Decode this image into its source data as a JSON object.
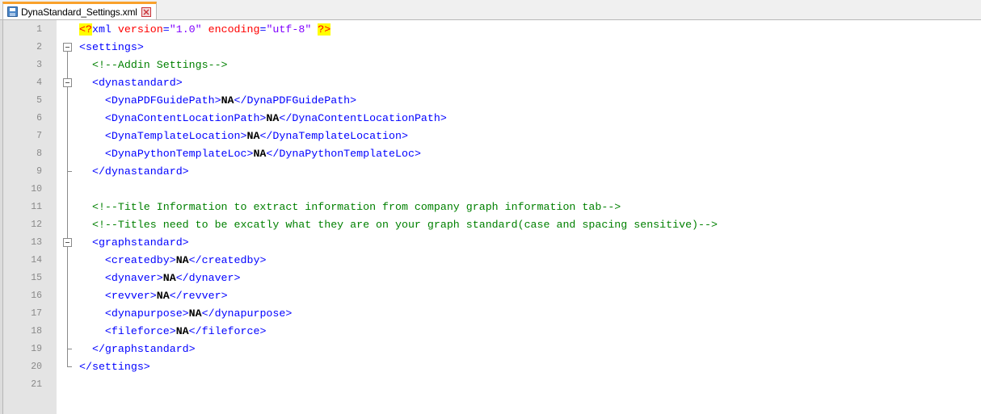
{
  "tab": {
    "filename": "DynaStandard_Settings.xml",
    "icon": "save-icon",
    "close_icon": "close-icon"
  },
  "colors": {
    "tag": "#0000ff",
    "attribute": "#ff0000",
    "string": "#8000ff",
    "comment": "#008000",
    "text": "#000000",
    "highlight": "#ffff00",
    "tab_accent": "#f9a12b"
  },
  "lines": [
    {
      "n": "1",
      "segs": [
        [
          "pi-hl",
          "<?"
        ],
        [
          "tag",
          "xml "
        ],
        [
          "attr",
          "version"
        ],
        [
          "tag",
          "="
        ],
        [
          "str",
          "\"1.0\""
        ],
        [
          "tag",
          " "
        ],
        [
          "attr",
          "encoding"
        ],
        [
          "tag",
          "="
        ],
        [
          "str",
          "\"utf-8\""
        ],
        [
          "tag",
          " "
        ],
        [
          "pi-hl",
          "?>"
        ]
      ]
    },
    {
      "n": "2",
      "segs": [
        [
          "tag",
          "<settings>"
        ]
      ]
    },
    {
      "n": "3",
      "segs": [
        [
          "cmt",
          "  <!--Addin Settings-->"
        ]
      ]
    },
    {
      "n": "4",
      "segs": [
        [
          "tag",
          "  <dynastandard>"
        ]
      ]
    },
    {
      "n": "5",
      "segs": [
        [
          "tag",
          "    <DynaPDFGuidePath>"
        ],
        [
          "txt",
          "NA"
        ],
        [
          "tag",
          "</DynaPDFGuidePath>"
        ]
      ]
    },
    {
      "n": "6",
      "segs": [
        [
          "tag",
          "    <DynaContentLocationPath>"
        ],
        [
          "txt",
          "NA"
        ],
        [
          "tag",
          "</DynaContentLocationPath>"
        ]
      ]
    },
    {
      "n": "7",
      "segs": [
        [
          "tag",
          "    <DynaTemplateLocation>"
        ],
        [
          "txt",
          "NA"
        ],
        [
          "tag",
          "</DynaTemplateLocation>"
        ]
      ]
    },
    {
      "n": "8",
      "segs": [
        [
          "tag",
          "    <DynaPythonTemplateLoc>"
        ],
        [
          "txt",
          "NA"
        ],
        [
          "tag",
          "</DynaPythonTemplateLoc>"
        ]
      ]
    },
    {
      "n": "9",
      "segs": [
        [
          "tag",
          "  </dynastandard>"
        ]
      ]
    },
    {
      "n": "10",
      "segs": []
    },
    {
      "n": "11",
      "segs": [
        [
          "cmt",
          "  <!--Title Information to extract information from company graph information tab-->"
        ]
      ]
    },
    {
      "n": "12",
      "segs": [
        [
          "cmt",
          "  <!--Titles need to be excatly what they are on your graph standard(case and spacing sensitive)-->"
        ]
      ]
    },
    {
      "n": "13",
      "segs": [
        [
          "tag",
          "  <graphstandard>"
        ]
      ]
    },
    {
      "n": "14",
      "segs": [
        [
          "tag",
          "    <createdby>"
        ],
        [
          "txt",
          "NA"
        ],
        [
          "tag",
          "</createdby>"
        ]
      ]
    },
    {
      "n": "15",
      "segs": [
        [
          "tag",
          "    <dynaver>"
        ],
        [
          "txt",
          "NA"
        ],
        [
          "tag",
          "</dynaver>"
        ]
      ]
    },
    {
      "n": "16",
      "segs": [
        [
          "tag",
          "    <revver>"
        ],
        [
          "txt",
          "NA"
        ],
        [
          "tag",
          "</revver>"
        ]
      ]
    },
    {
      "n": "17",
      "segs": [
        [
          "tag",
          "    <dynapurpose>"
        ],
        [
          "txt",
          "NA"
        ],
        [
          "tag",
          "</dynapurpose>"
        ]
      ]
    },
    {
      "n": "18",
      "segs": [
        [
          "tag",
          "    <fileforce>"
        ],
        [
          "txt",
          "NA"
        ],
        [
          "tag",
          "</fileforce>"
        ]
      ]
    },
    {
      "n": "19",
      "segs": [
        [
          "tag",
          "  </graphstandard>"
        ]
      ]
    },
    {
      "n": "20",
      "segs": [
        [
          "tag",
          "</settings>"
        ]
      ]
    },
    {
      "n": "21",
      "segs": []
    }
  ]
}
